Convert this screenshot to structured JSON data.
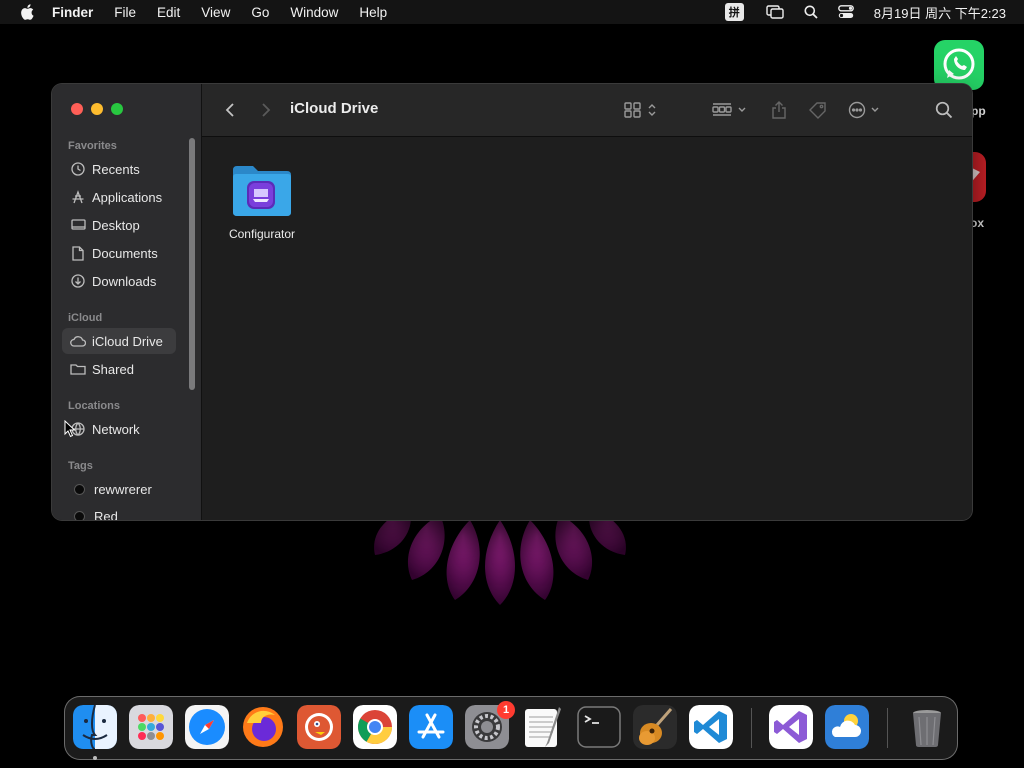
{
  "menubar": {
    "app_name": "Finder",
    "items": [
      "File",
      "Edit",
      "View",
      "Go",
      "Window",
      "Help"
    ],
    "input_method": "拼",
    "clock": "8月19日 周六  下午2:23"
  },
  "desktop": {
    "icons": [
      {
        "name": "WhatsApp",
        "label_visible": "pp"
      },
      {
        "name": "Parallels Toolbox",
        "label_visible": "ox"
      }
    ]
  },
  "window": {
    "title": "iCloud Drive",
    "sidebar": {
      "sections": [
        {
          "label": "Favorites",
          "items": [
            {
              "label": "Recents",
              "icon": "clock-icon"
            },
            {
              "label": "Applications",
              "icon": "applications-icon"
            },
            {
              "label": "Desktop",
              "icon": "desktop-icon"
            },
            {
              "label": "Documents",
              "icon": "document-icon"
            },
            {
              "label": "Downloads",
              "icon": "download-icon"
            }
          ]
        },
        {
          "label": "iCloud",
          "items": [
            {
              "label": "iCloud Drive",
              "icon": "cloud-icon",
              "selected": true
            },
            {
              "label": "Shared",
              "icon": "shared-folder-icon"
            }
          ]
        },
        {
          "label": "Locations",
          "items": [
            {
              "label": "Network",
              "icon": "network-icon"
            }
          ]
        },
        {
          "label": "Tags",
          "items": [
            {
              "label": "rewwrerer",
              "icon": "tag-dot"
            },
            {
              "label": "Red",
              "icon": "tag-dot"
            }
          ]
        }
      ]
    },
    "files": [
      {
        "label": "Configurator",
        "icon": "folder-icon"
      }
    ]
  },
  "dock": {
    "apps": [
      "Finder",
      "Launchpad",
      "Safari",
      "Firefox",
      "DuckDuckGo",
      "Chrome",
      "App Store",
      "System Settings",
      "TextEdit",
      "Terminal",
      "GarageBand",
      "Visual Studio Code",
      "Visual Studio",
      "Weather",
      "Trash"
    ],
    "system_settings_badge": "1"
  },
  "colors": {
    "close": "#ff5f57",
    "minimize": "#febc2e",
    "zoom": "#28c840",
    "folder": "#3aa7e8"
  }
}
